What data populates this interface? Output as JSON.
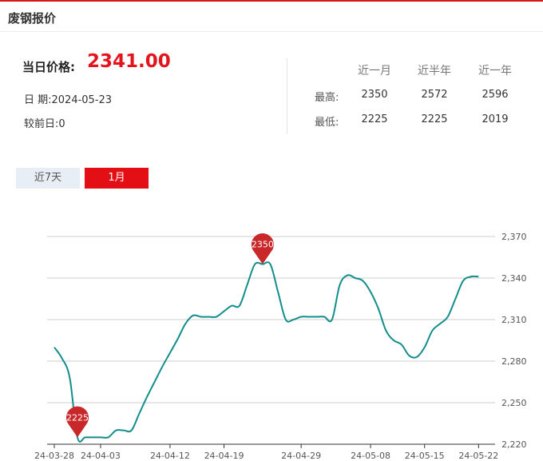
{
  "header": {
    "title": "废钢报价"
  },
  "summary": {
    "price_label": "当日价格:",
    "price_value": "2341.00",
    "date_text": "日 期:2024-05-23",
    "change_text": "较前日:0"
  },
  "stats": {
    "col_headers": [
      "近一月",
      "近半年",
      "近一年"
    ],
    "rows": [
      {
        "label": "最高:",
        "values": [
          "2350",
          "2572",
          "2596"
        ]
      },
      {
        "label": "最低:",
        "values": [
          "2225",
          "2225",
          "2019"
        ]
      }
    ]
  },
  "tabs": [
    {
      "label": "近7天",
      "active": false
    },
    {
      "label": "1月",
      "active": true
    }
  ],
  "colors": {
    "accent": "#e30f14",
    "line": "#138c8c",
    "pin": "#c8282a"
  },
  "chart_data": {
    "type": "line",
    "x": [
      "24-03-28",
      "24-03-29",
      "24-03-30",
      "24-03-31",
      "24-04-01",
      "24-04-02",
      "24-04-03",
      "24-04-04",
      "24-04-05",
      "24-04-06",
      "24-04-07",
      "24-04-08",
      "24-04-09",
      "24-04-10",
      "24-04-11",
      "24-04-12",
      "24-04-13",
      "24-04-14",
      "24-04-15",
      "24-04-16",
      "24-04-17",
      "24-04-18",
      "24-04-19",
      "24-04-20",
      "24-04-21",
      "24-04-22",
      "24-04-23",
      "24-04-24",
      "24-04-25",
      "24-04-26",
      "24-04-27",
      "24-04-28",
      "24-04-29",
      "24-04-30",
      "24-05-01",
      "24-05-02",
      "24-05-03",
      "24-05-04",
      "24-05-05",
      "24-05-06",
      "24-05-07",
      "24-05-08",
      "24-05-09",
      "24-05-10",
      "24-05-11",
      "24-05-12",
      "24-05-13",
      "24-05-14",
      "24-05-15",
      "24-05-16",
      "24-05-17",
      "24-05-18",
      "24-05-19",
      "24-05-20",
      "24-05-21",
      "24-05-22",
      "24-05-23"
    ],
    "series": [
      {
        "values": [
          2290,
          2282,
          2268,
          2225,
          2225,
          2225,
          2225,
          2225,
          2230,
          2230,
          2230,
          2242,
          2254,
          2265,
          2276,
          2286,
          2296,
          2307,
          2313,
          2312,
          2312,
          2312,
          2316,
          2320,
          2320,
          2335,
          2350,
          2350,
          2350,
          2330,
          2310,
          2310,
          2312,
          2312,
          2312,
          2312,
          2310,
          2335,
          2342,
          2340,
          2338,
          2330,
          2318,
          2302,
          2295,
          2292,
          2284,
          2283,
          2290,
          2302,
          2307,
          2312,
          2325,
          2338,
          2341,
          2341
        ]
      }
    ],
    "x_ticks": [
      "24-03-28",
      "24-04-03",
      "24-04-12",
      "24-04-19",
      "24-04-29",
      "24-05-08",
      "24-05-15",
      "24-05-22"
    ],
    "y_ticks": [
      2220,
      2250,
      2280,
      2310,
      2340,
      2370
    ],
    "y_tick_labels": [
      "2,220",
      "2,250",
      "2,280",
      "2,310",
      "2,340",
      "2,370"
    ],
    "ylim": [
      2220,
      2370
    ],
    "annotations": [
      {
        "x": "24-03-31",
        "label": "2225"
      },
      {
        "x": "24-04-24",
        "label": "2350"
      }
    ],
    "grid": true
  }
}
